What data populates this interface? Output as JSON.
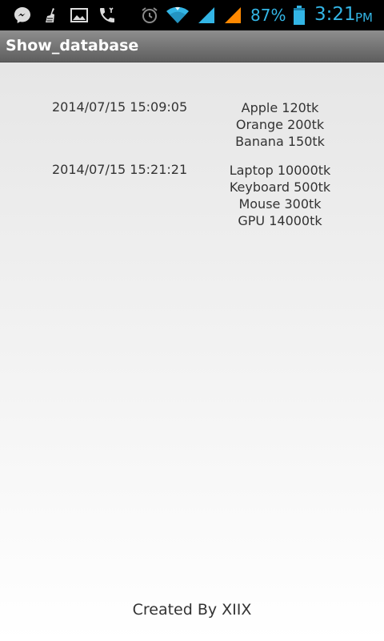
{
  "status_bar": {
    "icons": [
      "messenger-icon",
      "cleaner-icon",
      "gallery-icon",
      "call-icon",
      "alarm-icon",
      "wifi-icon",
      "signal-1-icon",
      "signal-2-icon",
      "battery-icon"
    ],
    "battery_percent": "87%",
    "time": "3:21",
    "ampm": "PM",
    "accent_color": "#33b5e5",
    "signal2_color": "#ff8800"
  },
  "title_bar": {
    "title": "Show_database"
  },
  "records": [
    {
      "datetime": "2014/07/15 15:09:05",
      "items": [
        "Apple 120tk",
        "Orange 200tk",
        "Banana 150tk"
      ]
    },
    {
      "datetime": "2014/07/15 15:21:21",
      "items": [
        "Laptop 10000tk",
        "Keyboard 500tk",
        "Mouse 300tk",
        "GPU 14000tk"
      ]
    }
  ],
  "footer": {
    "text": "Created By XIIX"
  }
}
